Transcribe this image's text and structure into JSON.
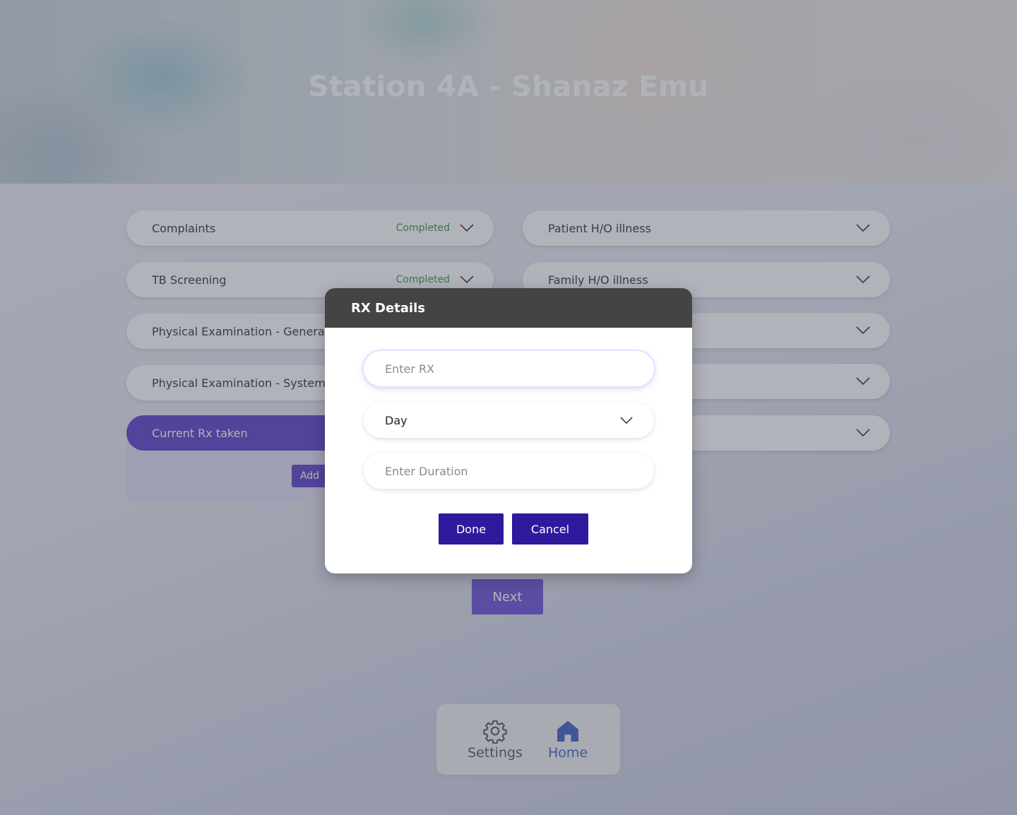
{
  "header": {
    "title": "Station 4A - Shanaz Emu"
  },
  "left_sections": [
    {
      "label": "Complaints",
      "status": "Completed"
    },
    {
      "label": "TB Screening",
      "status": "Completed"
    },
    {
      "label": "Physical Examination - General",
      "status": ""
    },
    {
      "label": "Physical Examination - Systemic",
      "status": ""
    },
    {
      "label": "Current Rx taken",
      "status": ""
    }
  ],
  "right_sections": [
    {
      "label": "Patient H/O illness"
    },
    {
      "label": "Family H/O illness"
    },
    {
      "label": ""
    },
    {
      "label": ""
    },
    {
      "label": ""
    }
  ],
  "current_rx": {
    "add_label": "Add"
  },
  "actions": {
    "next_label": "Next"
  },
  "bottom_nav": {
    "settings_label": "Settings",
    "home_label": "Home",
    "active": "Home"
  },
  "modal": {
    "title": "RX Details",
    "rx_input": {
      "placeholder": "Enter RX",
      "value": ""
    },
    "frequency_select": {
      "selected": "Day"
    },
    "duration_input": {
      "placeholder": "Enter Duration",
      "value": ""
    },
    "done_label": "Done",
    "cancel_label": "Cancel"
  },
  "colors": {
    "accent": "#5a40c8",
    "modal_button": "#2d1a9c",
    "completed": "#2e9a3e",
    "home_active": "#3f5fc0",
    "modal_header": "#444444"
  }
}
